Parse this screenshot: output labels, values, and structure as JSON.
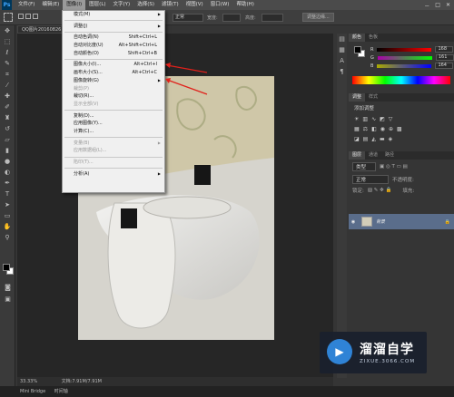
{
  "app": {
    "logo": "Ps"
  },
  "menubar": [
    "文件(F)",
    "编辑(E)",
    "图像(I)",
    "图层(L)",
    "文字(Y)",
    "选择(S)",
    "滤镜(T)",
    "视图(V)",
    "窗口(W)",
    "帮助(H)"
  ],
  "window_buttons": [
    "－",
    "□",
    "✕"
  ],
  "options": {
    "mode_label": "正常",
    "width_label": "宽度:",
    "height_label": "高度:",
    "refine_button": "调整边缘..."
  },
  "doc_tab": "QQ图片20160826",
  "status": {
    "zoom": "33.33%",
    "doc": "文档:7.91M/7.91M"
  },
  "bottom": {
    "bridge": "Mini Bridge",
    "timeline": "时间轴"
  },
  "image_menu": [
    {
      "label": "模式(M)",
      "submenu": true
    },
    {
      "sep": true
    },
    {
      "label": "调整(J)",
      "submenu": true
    },
    {
      "sep": true
    },
    {
      "label": "自动色调(N)",
      "shortcut": "Shift+Ctrl+L"
    },
    {
      "label": "自动对比度(U)",
      "shortcut": "Alt+Shift+Ctrl+L"
    },
    {
      "label": "自动颜色(O)",
      "shortcut": "Shift+Ctrl+B"
    },
    {
      "sep": true
    },
    {
      "label": "图像大小(I)...",
      "shortcut": "Alt+Ctrl+I"
    },
    {
      "label": "画布大小(S)...",
      "shortcut": "Alt+Ctrl+C"
    },
    {
      "label": "图像旋转(G)",
      "submenu": true
    },
    {
      "label": "裁剪(P)",
      "disabled": true
    },
    {
      "label": "裁切(R)..."
    },
    {
      "label": "显示全部(V)",
      "disabled": true
    },
    {
      "sep": true
    },
    {
      "label": "复制(D)..."
    },
    {
      "label": "应用图像(Y)..."
    },
    {
      "label": "计算(C)..."
    },
    {
      "sep": true
    },
    {
      "label": "变量(B)",
      "submenu": true,
      "disabled": true
    },
    {
      "label": "应用数据组(L)...",
      "disabled": true
    },
    {
      "sep": true
    },
    {
      "label": "陷印(T)...",
      "disabled": true
    },
    {
      "sep": true
    },
    {
      "label": "分析(A)",
      "submenu": true
    }
  ],
  "color_panel": {
    "tabs": [
      "颜色",
      "色板"
    ],
    "r": "168",
    "g": "161",
    "b": "164"
  },
  "adjust_panel": {
    "tabs": [
      "调整",
      "样式"
    ],
    "title": "添加调整"
  },
  "layers_panel": {
    "tabs": [
      "图层",
      "通道",
      "路径"
    ],
    "kind": "类型",
    "blend": "正常",
    "opacity_label": "不透明度:",
    "lock_label": "锁定:",
    "fill_label": "填充:",
    "layer_name": "背景"
  },
  "watermark": {
    "title": "溜溜自学",
    "url": "ZIXUE.3066.COM"
  },
  "colors": {
    "accent": "#e0211b",
    "selected_layer": "#5a6d8b"
  }
}
